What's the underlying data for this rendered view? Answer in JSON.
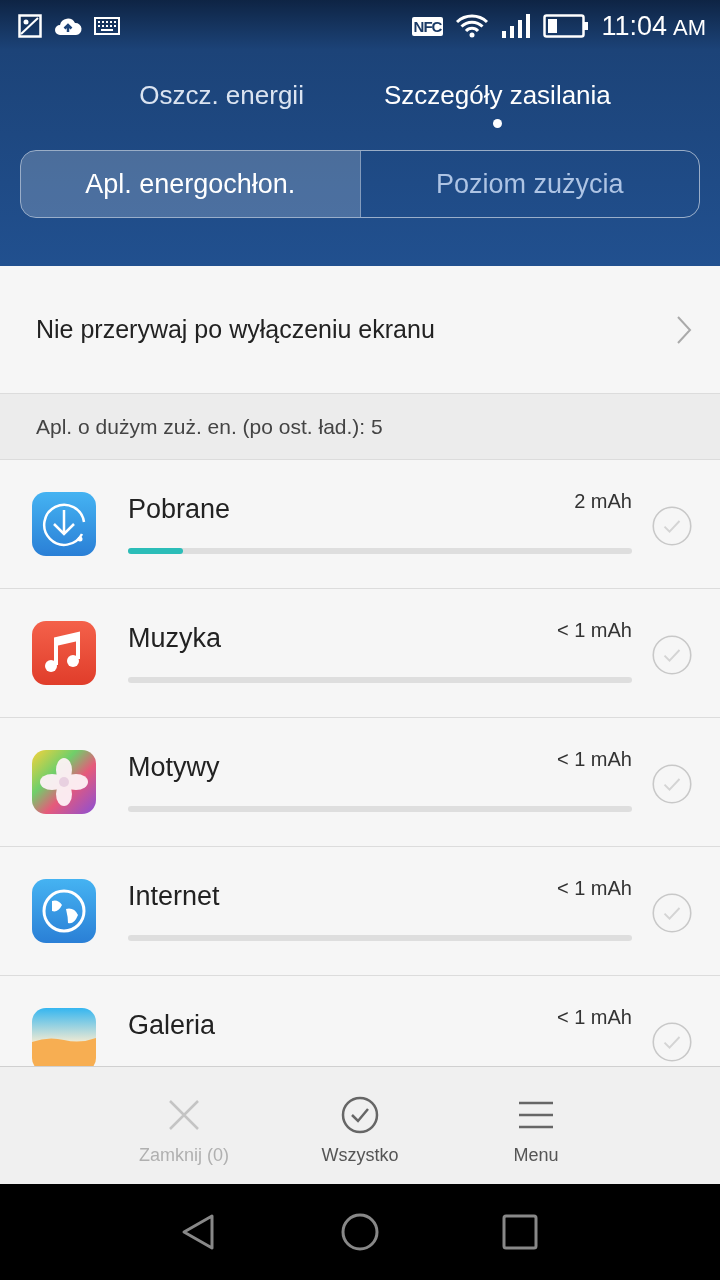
{
  "status_bar": {
    "nfc": "NFC",
    "time": "11:04",
    "period": "AM"
  },
  "page_tabs": [
    {
      "label": "Oszcz. energii",
      "selected": false
    },
    {
      "label": "Szczegóły zasilania",
      "selected": true
    }
  ],
  "segments": [
    {
      "label": "Apl. energochłon.",
      "selected": true
    },
    {
      "label": "Poziom zużycia",
      "selected": false
    }
  ],
  "settings_row": {
    "label": "Nie przerywaj po wyłączeniu ekranu"
  },
  "section_header": "Apl. o dużym zuż. en. (po ost. ład.): 5",
  "apps": [
    {
      "kind": "download",
      "name": "Pobrane",
      "usage": "2 mAh",
      "level": 0.11,
      "checked": false
    },
    {
      "kind": "music",
      "name": "Muzyka",
      "usage": "< 1 mAh",
      "level": 0,
      "checked": false
    },
    {
      "kind": "themes",
      "name": "Motywy",
      "usage": "< 1 mAh",
      "level": 0,
      "checked": false
    },
    {
      "kind": "browser",
      "name": "Internet",
      "usage": "< 1 mAh",
      "level": 0,
      "checked": false
    },
    {
      "kind": "gallery",
      "name": "Galeria",
      "usage": "< 1 mAh",
      "checked": false
    }
  ],
  "actions": [
    {
      "kind": "close",
      "label": "Zamknij (0)",
      "disabled": true
    },
    {
      "kind": "select-all",
      "label": "Wszystko",
      "disabled": false
    },
    {
      "kind": "menu",
      "label": "Menu",
      "disabled": false
    }
  ]
}
